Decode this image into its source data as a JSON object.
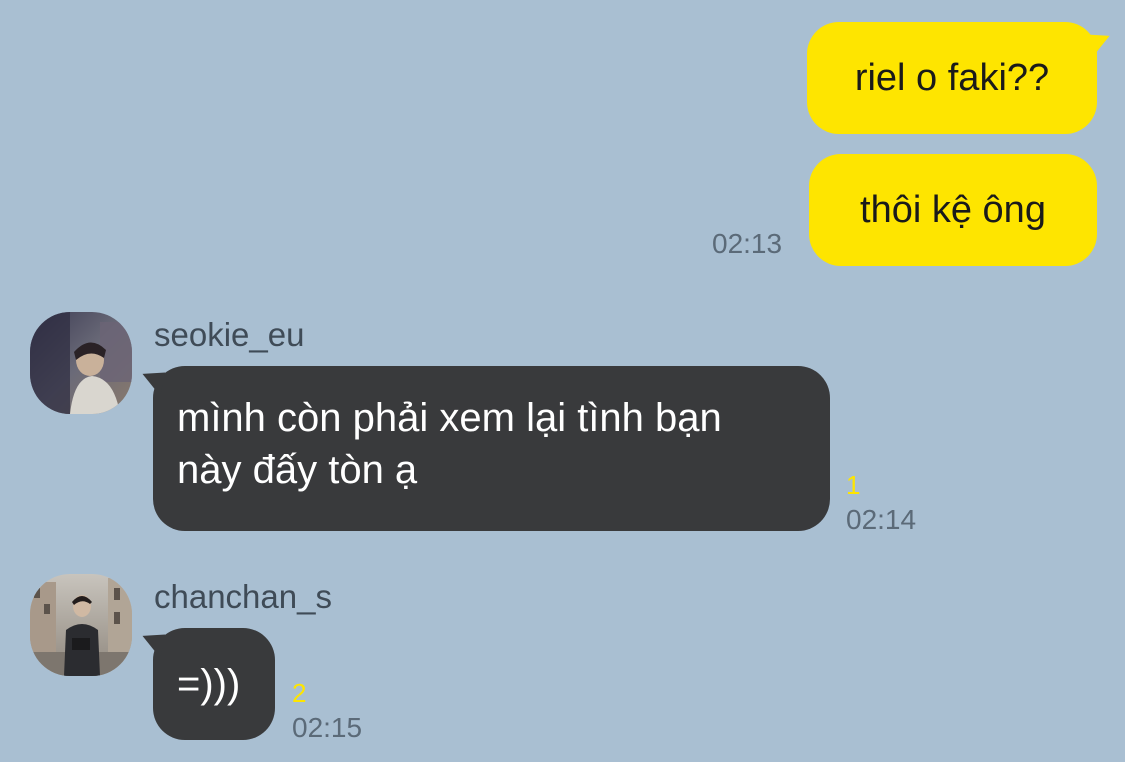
{
  "colors": {
    "background": "#a9bfd2",
    "outgoing_bubble": "#fee500",
    "incoming_bubble": "#393a3c",
    "unread_count": "#fee500"
  },
  "messages_out": [
    {
      "text": "riel o faki??"
    },
    {
      "text": "thôi kệ ông"
    }
  ],
  "out_time": "02:13",
  "messages_in": [
    {
      "sender": "seokie_eu",
      "avatar_icon": "profile-photo",
      "lines": [
        "mình còn phải xem lại tình bạn",
        "này đấy tòn ạ"
      ],
      "unread": "1",
      "time": "02:14"
    },
    {
      "sender": "chanchan_s",
      "avatar_icon": "profile-photo",
      "lines": [
        "=)))"
      ],
      "unread": "2",
      "time": "02:15"
    }
  ]
}
